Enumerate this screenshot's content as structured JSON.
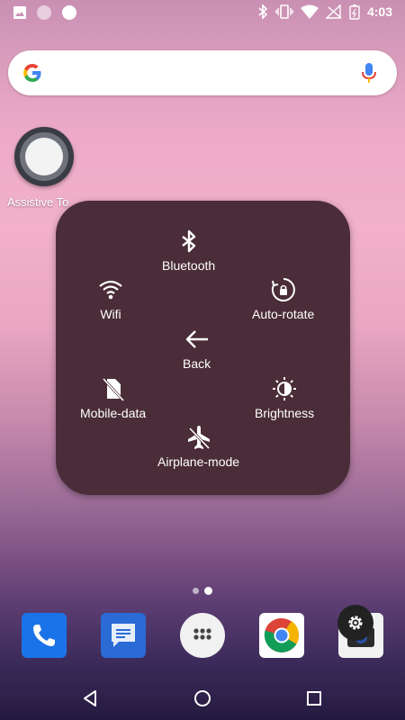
{
  "status_bar": {
    "time": "4:03",
    "left_icons": [
      "image-icon",
      "circle-icon",
      "circle-filled-icon"
    ],
    "right_icons": [
      "bluetooth-icon",
      "vibrate-icon",
      "wifi-icon",
      "no-signal-icon",
      "battery-icon"
    ]
  },
  "search_bar": {
    "logo": "google-g-icon",
    "mic": "mic-icon"
  },
  "assistive_touch": {
    "label": "Assistive To"
  },
  "menu": {
    "items": [
      {
        "id": "bluetooth",
        "label": "Bluetooth",
        "icon": "bluetooth-icon"
      },
      {
        "id": "wifi",
        "label": "Wifi",
        "icon": "wifi-icon"
      },
      {
        "id": "auto-rotate",
        "label": "Auto-rotate",
        "icon": "auto-rotate-icon"
      },
      {
        "id": "back",
        "label": "Back",
        "icon": "arrow-left-icon"
      },
      {
        "id": "mobile-data",
        "label": "Mobile-data",
        "icon": "mobile-data-off-icon"
      },
      {
        "id": "brightness",
        "label": "Brightness",
        "icon": "brightness-icon"
      },
      {
        "id": "airplane-mode",
        "label": "Airplane-mode",
        "icon": "airplane-icon"
      }
    ]
  },
  "page_indicator": {
    "pages": 2,
    "current": 2
  },
  "dock": {
    "apps": [
      {
        "name": "Phone",
        "icon": "phone-icon",
        "color": "#1a73e8"
      },
      {
        "name": "Messages",
        "icon": "messages-icon",
        "color": "#2a6bd6"
      },
      {
        "name": "Apps",
        "icon": "app-drawer-icon",
        "color": "#f1f1f1"
      },
      {
        "name": "Chrome",
        "icon": "chrome-icon",
        "color": "#ffffff"
      },
      {
        "name": "Camera",
        "icon": "camera-icon",
        "color": "#f2f2f2"
      }
    ],
    "overlay": "settings-gear-icon"
  },
  "nav_bar": {
    "buttons": [
      "back-icon",
      "home-icon",
      "recents-icon"
    ]
  },
  "colors": {
    "panel": "#4a2d38",
    "accent_blue": "#1a73e8"
  }
}
